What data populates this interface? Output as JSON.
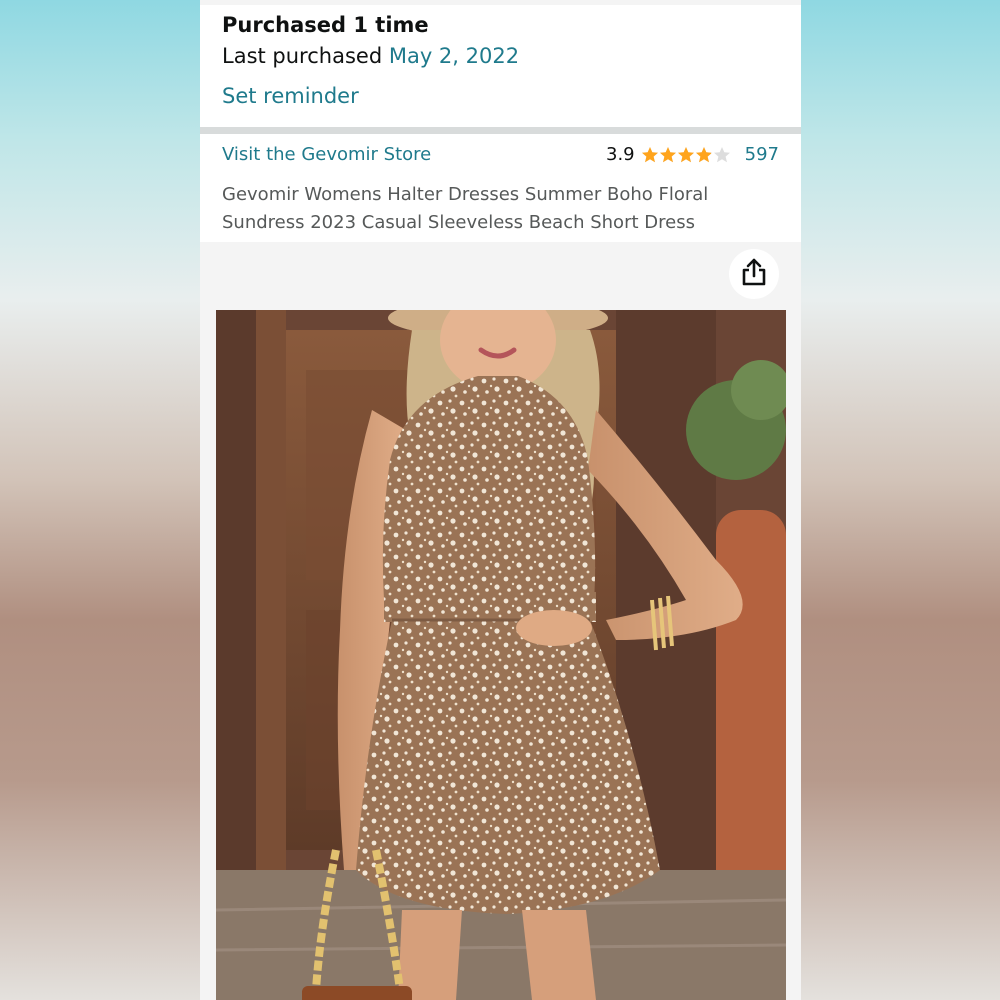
{
  "purchase": {
    "count_text": "Purchased 1 time",
    "last_label": "Last purchased",
    "last_date": "May 2, 2022",
    "reminder_label": "Set reminder"
  },
  "store": {
    "link_label": "Visit the Gevomir Store"
  },
  "rating": {
    "value": "3.9",
    "stars_filled": 3.9,
    "stars_total": 5,
    "count": "597",
    "star_color": "#ffa41c"
  },
  "product": {
    "title": "Gevomir Womens Halter Dresses Summer Boho Floral Sundress 2023 Casual Sleeveless Beach Short Dress"
  },
  "icons": {
    "share": "share-icon",
    "star": "star-icon"
  },
  "colors": {
    "link": "#1f7a8c",
    "text": "#0f1111",
    "muted": "#565959"
  }
}
